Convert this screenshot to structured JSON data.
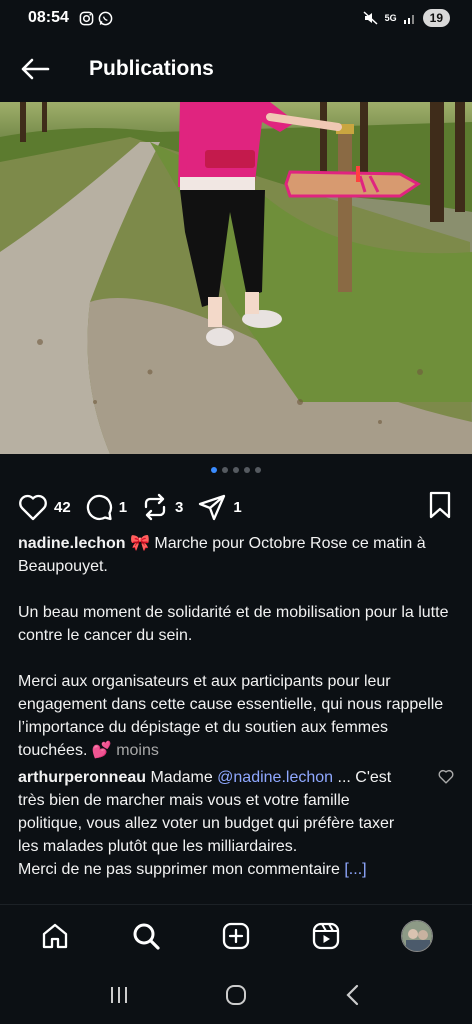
{
  "status_bar": {
    "time": "08:54",
    "left_icons": [
      "instagram-icon",
      "whatsapp-icon"
    ],
    "network": "5G",
    "battery": "19"
  },
  "header": {
    "title": "Publications"
  },
  "carousel": {
    "total": 5,
    "active_index": 0
  },
  "actions": {
    "likes": "42",
    "comments": "1",
    "reposts": "3",
    "shares": "1"
  },
  "caption": {
    "username": "nadine.lechon",
    "emoji_ribbon": "🎀",
    "line1": " Marche pour Octobre Rose ce matin à Beaupouyet.",
    "paragraph2": "Un beau moment de solidarité et de mobilisation pour la lutte contre le cancer du sein.",
    "paragraph3": "Merci aux organisateurs et aux participants pour leur engagement dans cette cause essentielle, qui nous rappelle l’importance du dépistage et du soutien aux femmes touchées. ",
    "emoji_hearts": "💕",
    "less_label": " moins"
  },
  "comment": {
    "username": "arthurperonneau",
    "prefix": " Madame ",
    "mention": "@nadine.lechon",
    "text": " ... C'est très bien de marcher mais vous et votre famille politique, vous allez voter un budget qui préfère taxer les malades plutôt que les milliardaires.",
    "text2": "Merci de ne pas supprimer mon commentaire ",
    "more": "[...]"
  },
  "bottom_nav": [
    "home-icon",
    "search-icon",
    "create-icon",
    "reels-icon",
    "profile-avatar"
  ],
  "colors": {
    "background": "#0c1014",
    "accent_blue": "#3a8cff",
    "mention": "#8fa8ff",
    "pink": "#e0247f"
  }
}
